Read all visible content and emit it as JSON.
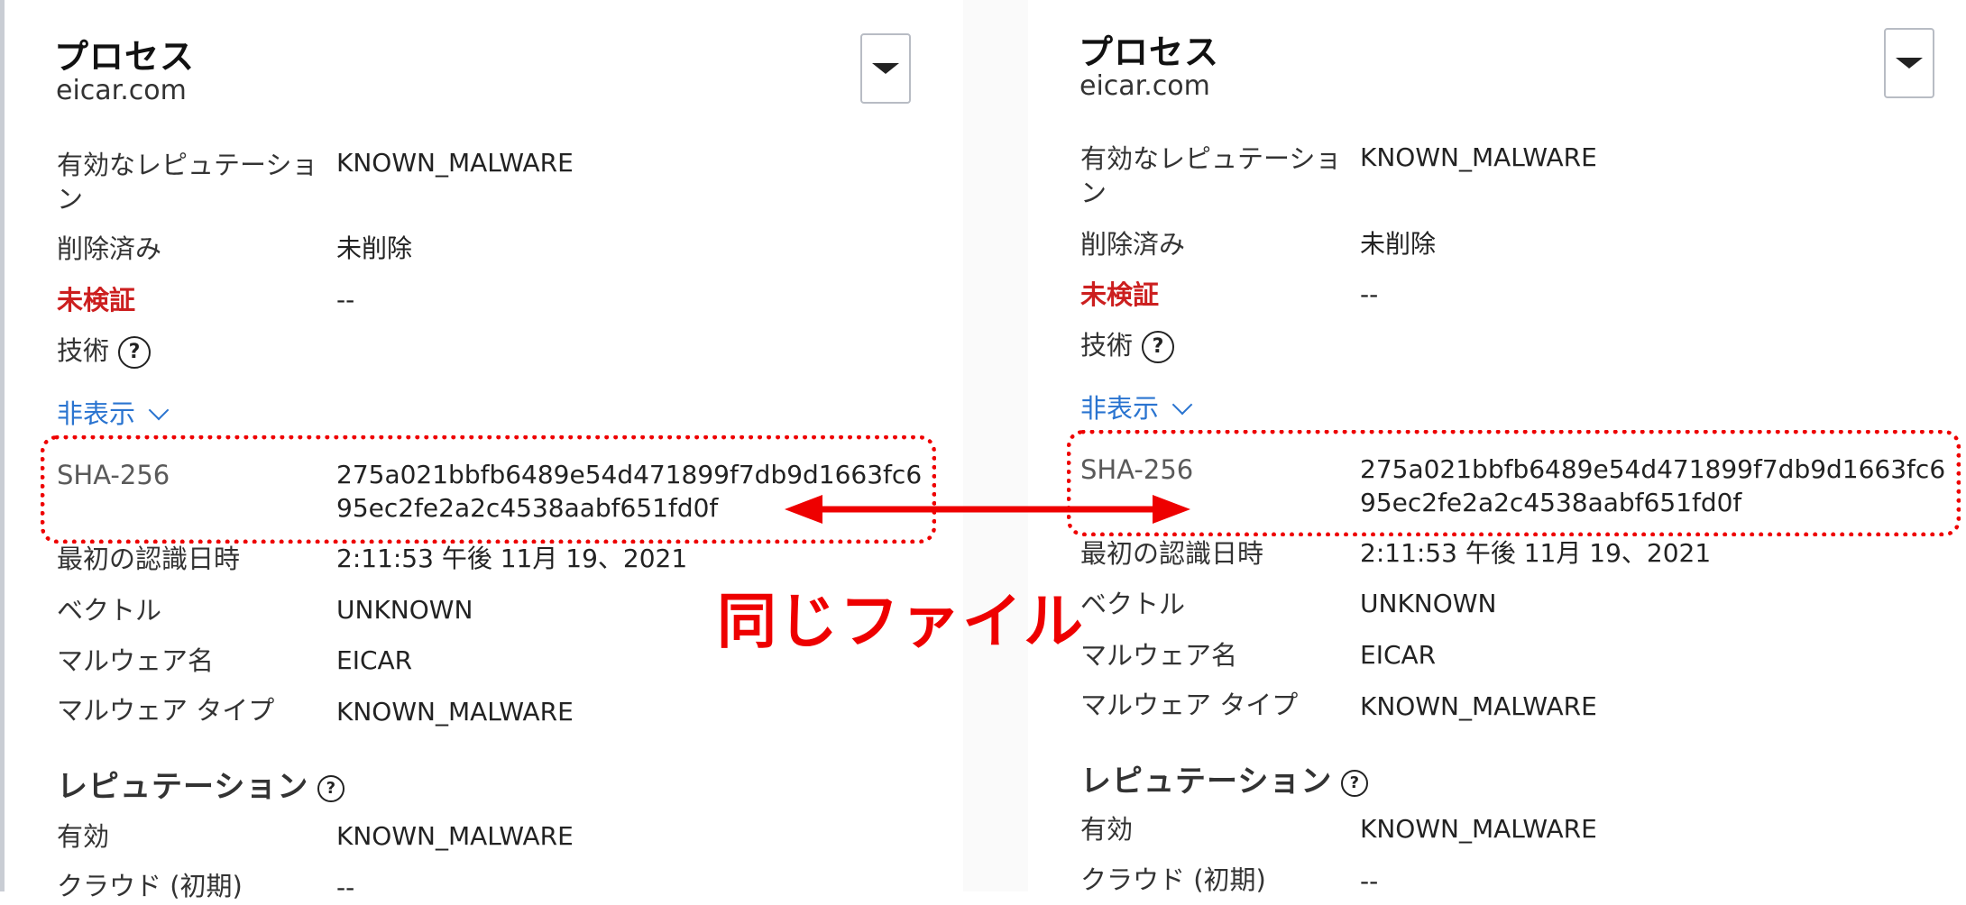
{
  "panels": [
    {
      "title": "プロセス",
      "subtitle": "eicar.com",
      "rows": [
        {
          "label": "有効なレピュテーション",
          "value": "KNOWN_MALWARE"
        },
        {
          "label": "削除済み",
          "value": "未削除"
        },
        {
          "label": "未検証",
          "value": "--"
        },
        {
          "label": "技術",
          "value": ""
        }
      ],
      "toggle_label": "非表示",
      "sha_label": "SHA-256",
      "sha_value": "275a021bbfb6489e54d471899f7db9d1663fc695ec2fe2a2c4538aabf651fd0f",
      "details": [
        {
          "label": "最初の認識日時",
          "value": "2:11:53 午後 11月 19、2021"
        },
        {
          "label": "ベクトル",
          "value": "UNKNOWN"
        },
        {
          "label": "マルウェア名",
          "value": "EICAR"
        },
        {
          "label": "マルウェア タイプ",
          "value": "KNOWN_MALWARE"
        }
      ],
      "reputation_section": "レピュテーション",
      "reputation_rows": [
        {
          "label": "有効",
          "value": "KNOWN_MALWARE"
        },
        {
          "label": "クラウド (初期)",
          "value": "--"
        }
      ]
    },
    {
      "title": "プロセス",
      "subtitle": "eicar.com",
      "rows": [
        {
          "label": "有効なレピュテーション",
          "value": "KNOWN_MALWARE"
        },
        {
          "label": "削除済み",
          "value": "未削除"
        },
        {
          "label": "未検証",
          "value": "--"
        },
        {
          "label": "技術",
          "value": ""
        }
      ],
      "toggle_label": "非表示",
      "sha_label": "SHA-256",
      "sha_value": "275a021bbfb6489e54d471899f7db9d1663fc695ec2fe2a2c4538aabf651fd0f",
      "details": [
        {
          "label": "最初の認識日時",
          "value": "2:11:53 午後 11月 19、2021"
        },
        {
          "label": "ベクトル",
          "value": "UNKNOWN"
        },
        {
          "label": "マルウェア名",
          "value": "EICAR"
        },
        {
          "label": "マルウェア タイプ",
          "value": "KNOWN_MALWARE"
        }
      ],
      "reputation_section": "レピュテーション",
      "reputation_rows": [
        {
          "label": "有効",
          "value": "KNOWN_MALWARE"
        },
        {
          "label": "クラウド (初期)",
          "value": "--"
        }
      ]
    }
  ],
  "annotation": {
    "text": "同じファイル",
    "color": "#ee0000"
  },
  "colors": {
    "unverified_label": "#cc1f1f",
    "link": "#2a74d0"
  },
  "icons": {
    "dropdown": "caret-down-icon",
    "help": "question-circle-icon",
    "toggle": "chevron-down-icon",
    "arrow": "double-headed-arrow-icon"
  }
}
